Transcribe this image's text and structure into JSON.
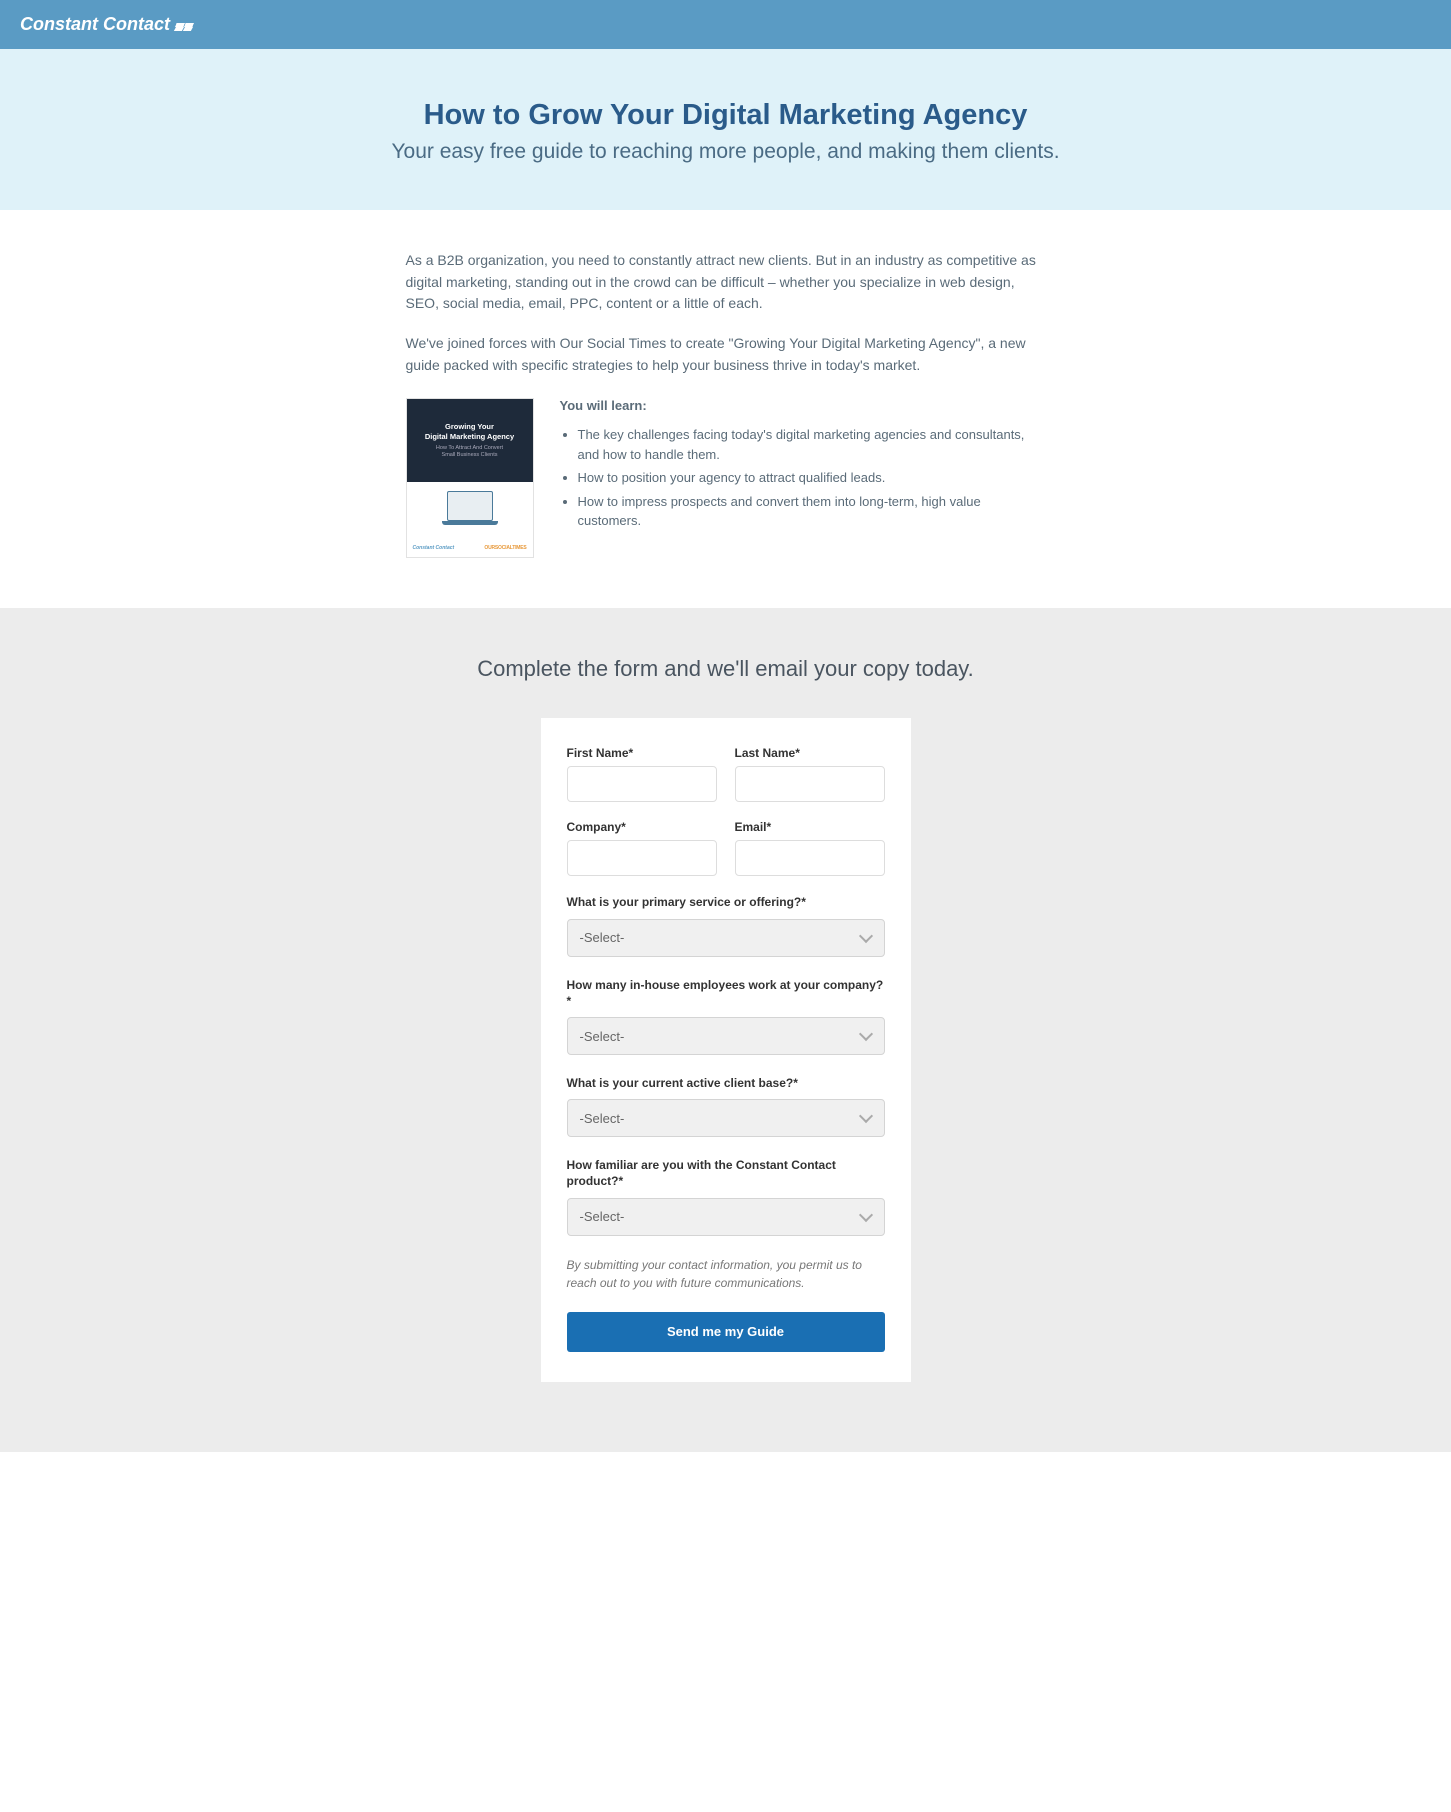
{
  "brand": "Constant Contact",
  "hero": {
    "title": "How to Grow Your Digital Marketing Agency",
    "subtitle": "Your easy free guide to reaching more people, and making them clients."
  },
  "content": {
    "para1": "As a B2B organization, you need to constantly attract new clients. But in an industry as competitive as digital marketing, standing out in the crowd can be difficult – whether you specialize in web design, SEO, social media, email, PPC, content or a little of each.",
    "para2": "We've joined forces with Our Social Times to create \"Growing Your Digital Marketing Agency\", a new guide packed with specific strategies to help your business thrive in today's market."
  },
  "guide_cover": {
    "line1": "Growing Your",
    "line2": "Digital Marketing Agency",
    "line3": "How To Attract And Convert",
    "line4": "Small Business Clients",
    "footer_left": "Constant Contact",
    "footer_right": "OURSOCIALTIMES"
  },
  "learn": {
    "heading": "You will learn:",
    "items": [
      "The key challenges facing today's digital marketing agencies and consultants, and how to handle them.",
      "How to position your agency to attract qualified leads.",
      "How to impress prospects and convert them into long-term, high value customers."
    ]
  },
  "form": {
    "heading": "Complete the form and we'll email your copy today.",
    "fields": {
      "first_name": "First Name*",
      "last_name": "Last Name*",
      "company": "Company*",
      "email": "Email*"
    },
    "selects": {
      "primary_service": {
        "label": "What is your primary service or offering?*",
        "placeholder": "-Select-"
      },
      "employees": {
        "label": "How many in-house employees work at your company?*",
        "placeholder": "-Select-"
      },
      "client_base": {
        "label": "What is your current active client base?*",
        "placeholder": "-Select-"
      },
      "familiarity": {
        "label": "How familiar are you with the Constant Contact product?*",
        "placeholder": "-Select-"
      }
    },
    "disclaimer": "By submitting your contact information, you permit us to reach out to you with future communications.",
    "submit": "Send me my Guide"
  }
}
